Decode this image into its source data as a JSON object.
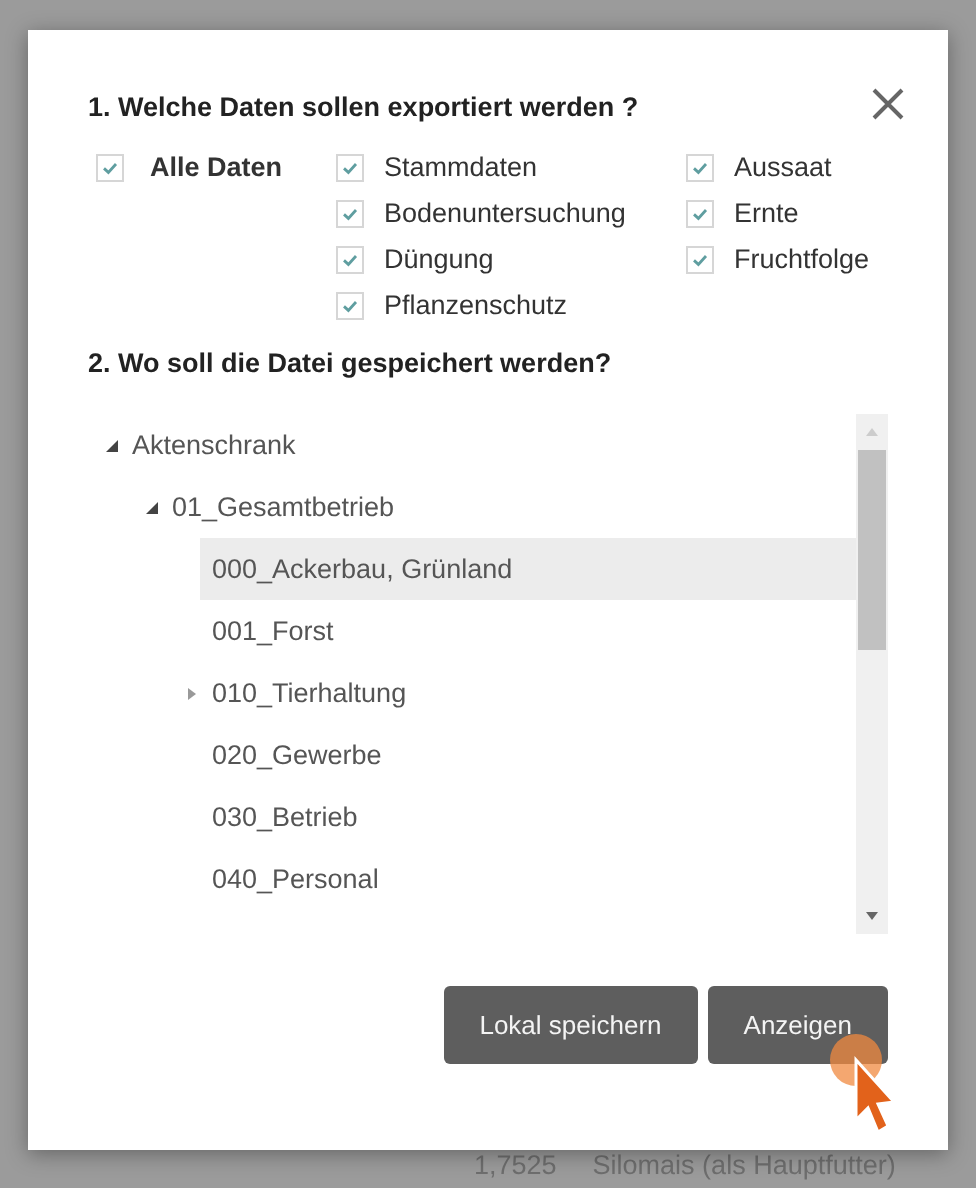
{
  "dialog": {
    "section_1_title": "1. Welche Daten sollen exportiert werden ?",
    "option_columns": [
      [
        {
          "label": "Alle Daten",
          "kind": "all",
          "checked": true
        }
      ],
      [
        {
          "label": "Stammdaten",
          "kind": "item",
          "checked": true
        },
        {
          "label": "Bodenuntersuchung",
          "kind": "item",
          "checked": true
        },
        {
          "label": "Düngung",
          "kind": "item",
          "checked": true
        },
        {
          "label": "Pflanzenschutz",
          "kind": "item",
          "checked": true
        }
      ],
      [
        {
          "label": "Aussaat",
          "kind": "item",
          "checked": true
        },
        {
          "label": "Ernte",
          "kind": "item",
          "checked": true
        },
        {
          "label": "Fruchtfolge",
          "kind": "item",
          "checked": true
        }
      ]
    ],
    "section_2_title": "2. Wo soll die Datei gespeichert werden?",
    "tree": [
      {
        "label": "Aktenschrank",
        "kind": "branch",
        "expanded": true,
        "selected": false,
        "children": [
          {
            "label": "01_Gesamtbetrieb",
            "kind": "branch",
            "expanded": true,
            "selected": false,
            "children": [
              {
                "label": "000_Ackerbau, Grünland",
                "kind": "leaf",
                "selected": true
              },
              {
                "label": "001_Forst",
                "kind": "leaf",
                "selected": false
              },
              {
                "label": "010_Tierhaltung",
                "kind": "branch",
                "expanded": false,
                "selected": false
              },
              {
                "label": "020_Gewerbe",
                "kind": "leaf",
                "selected": false
              },
              {
                "label": "030_Betrieb",
                "kind": "leaf",
                "selected": false
              },
              {
                "label": "040_Personal",
                "kind": "leaf",
                "selected": false
              }
            ]
          }
        ]
      }
    ],
    "buttons": [
      "Lokal speichern",
      "Anzeigen"
    ]
  },
  "background": {
    "texts": [
      "1,7525",
      "Silomais (als Hauptfutter)"
    ]
  }
}
